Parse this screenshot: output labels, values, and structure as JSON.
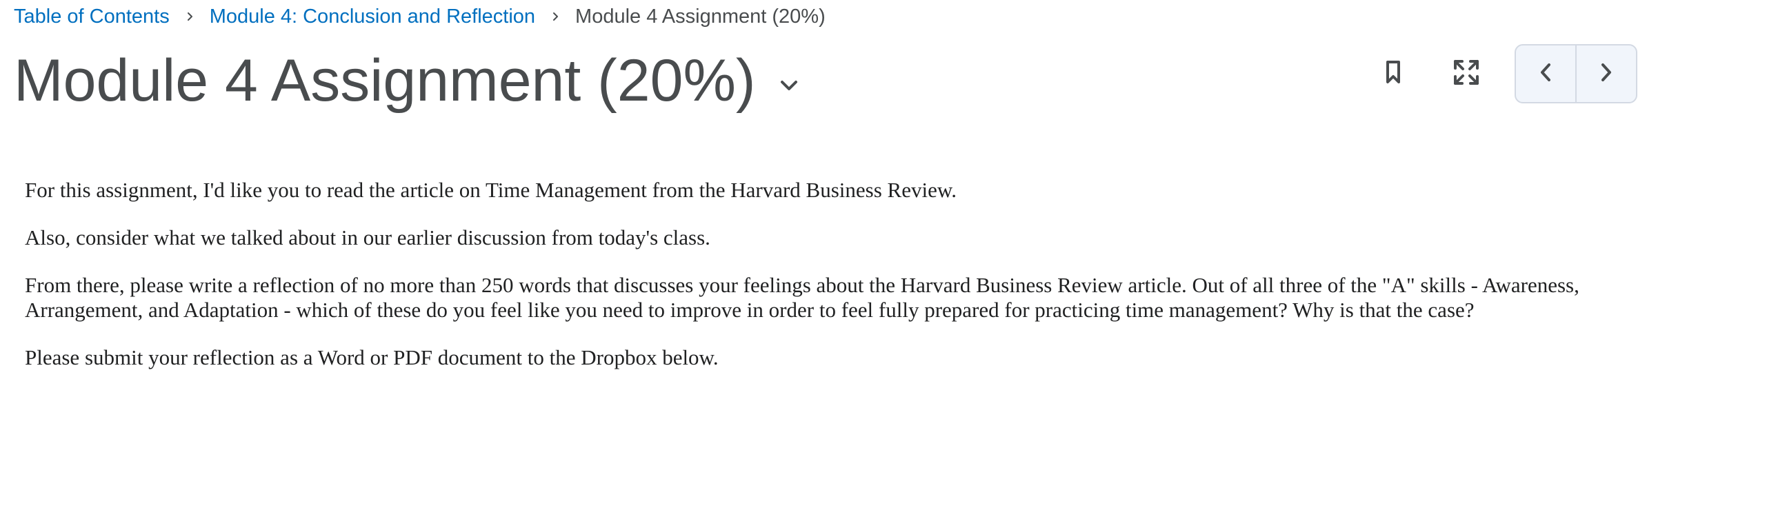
{
  "breadcrumbs": {
    "items": [
      {
        "label": "Table of Contents"
      },
      {
        "label": "Module 4: Conclusion and Reflection"
      },
      {
        "label": "Module 4 Assignment (20%)"
      }
    ]
  },
  "header": {
    "title": "Module 4 Assignment (20%)"
  },
  "toolbar": {
    "icons": [
      "bookmark-icon",
      "fullscreen-icon",
      "chevron-left-icon",
      "chevron-right-icon"
    ]
  },
  "content": {
    "paragraphs": [
      "For this assignment, I'd like you to read the article on Time Management from the Harvard Business Review.",
      "Also, consider what we talked about in our earlier discussion from today's class.",
      "From there, please write a reflection of no more than 250 words that discusses your feelings about the Harvard Business Review article. Out of all three of the \"A\" skills - Awareness, Arrangement, and Adaptation - which of these do you feel like you need to improve in order to feel fully prepared for practicing time management? Why is that the case?",
      "Please submit your reflection as a Word or PDF document to the Dropbox below."
    ]
  },
  "colors": {
    "link": "#006fbf",
    "text": "#494c4e",
    "body_text": "#202122",
    "nav_bg": "#f1f5fb",
    "nav_border": "#d3d9e3"
  }
}
